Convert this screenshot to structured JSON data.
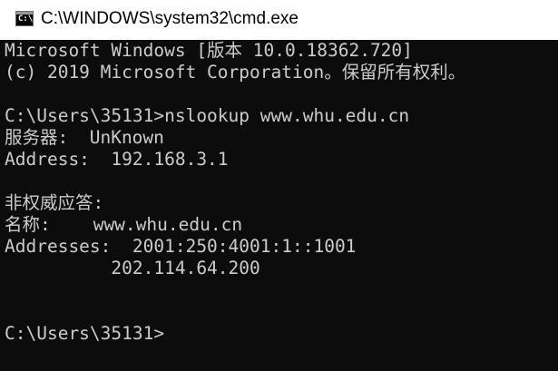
{
  "window": {
    "title": "C:\\WINDOWS\\system32\\cmd.exe",
    "icon": "command-prompt-icon"
  },
  "console": {
    "lines": [
      "Microsoft Windows [版本 10.0.18362.720]",
      "(c) 2019 Microsoft Corporation。保留所有权利。",
      "",
      "C:\\Users\\35131>nslookup www.whu.edu.cn",
      "服务器:  UnKnown",
      "Address:  192.168.3.1",
      "",
      "非权威应答:",
      "名称:    www.whu.edu.cn",
      "Addresses:  2001:250:4001:1::1001",
      "          202.114.64.200",
      "",
      "",
      "C:\\Users\\35131>"
    ]
  },
  "colors": {
    "console_background": "#0c0c0c",
    "console_text": "#cccccc",
    "titlebar_background": "#ffffff"
  }
}
